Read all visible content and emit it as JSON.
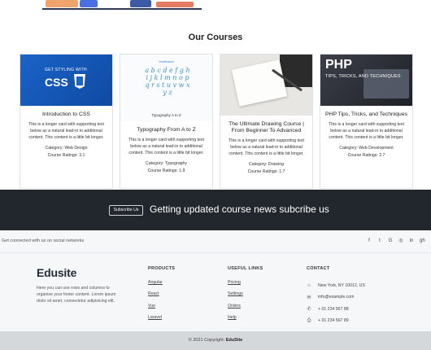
{
  "section_title": "Our Courses",
  "cards": [
    {
      "thumb_label": "GET STYLING WITH",
      "thumb_big": "CSS",
      "title": "Introduction to CSS",
      "text": "This is a longer card with supporting text below as a natural lead-in to additional content. This content is a little bit longer.",
      "category": "Category: Web Design",
      "ratings": "Course Ratings: 3.1"
    },
    {
      "thumb_label": "Youthwork",
      "thumb_letters": "a b c d e f g h i j k l m n o p q r s t u v w x y z",
      "thumb_caption": "Typography A to Z",
      "title": "Typography From A to Z",
      "text": "This is a longer card with supporting text below as a natural lead-in to additional content. This content is a little bit longer.",
      "category": "Category: Typography",
      "ratings": "Course Ratings: 1.9"
    },
    {
      "title": "The Ultimate Drawing Course | From Beginner To Advanced",
      "text": "This is a longer card with supporting text below as a natural lead-in to additional content. This content is a little bit longer.",
      "category": "Category: Drawing",
      "ratings": "Course Ratings: 1.7"
    },
    {
      "thumb_big": "PHP",
      "thumb_label": "TIPS, TRICKS, AND TECHNIQUES",
      "title": "PHP Tips, Tricks, and Techniques",
      "text": "This is a longer card with supporting text below as a natural lead-in to additional content. This content is a little bit longer.",
      "category": "Category: Web Development",
      "ratings": "Course Ratings: 2.7"
    }
  ],
  "band": {
    "button": "Subscribe Us",
    "message": "Getting updated course news subcribe us"
  },
  "social": {
    "label": "Get connected with us on social networks",
    "icons": [
      "f",
      "t",
      "G",
      "◎",
      "in",
      "gh"
    ]
  },
  "footer": {
    "logo": "Edusite",
    "about": "Here you can use rows and columns to organize your footer content. Lorem ipsum dolor sit amet, consectetur adipisicing elit.",
    "products": {
      "heading": "PRODUCTS",
      "items": [
        "Angular",
        "React",
        "Vue",
        "Laravel"
      ]
    },
    "links": {
      "heading": "USEFUL LINKS",
      "items": [
        "Pricing",
        "Settings",
        "Orders",
        "Help"
      ]
    },
    "contact": {
      "heading": "CONTACT",
      "items": [
        "New York, NY 10012, US",
        "info@example.com",
        "+ 01 234 567 88",
        "+ 01 234 567 89"
      ]
    }
  },
  "copyright": {
    "prefix": "© 2021 Copyright:",
    "brand": "EduSite"
  },
  "colors": {
    "band_bg": "#22272e",
    "footer_bg": "#f6f7f8",
    "copy_bg": "#d5d8db",
    "css_blue": "#1a63c7"
  }
}
